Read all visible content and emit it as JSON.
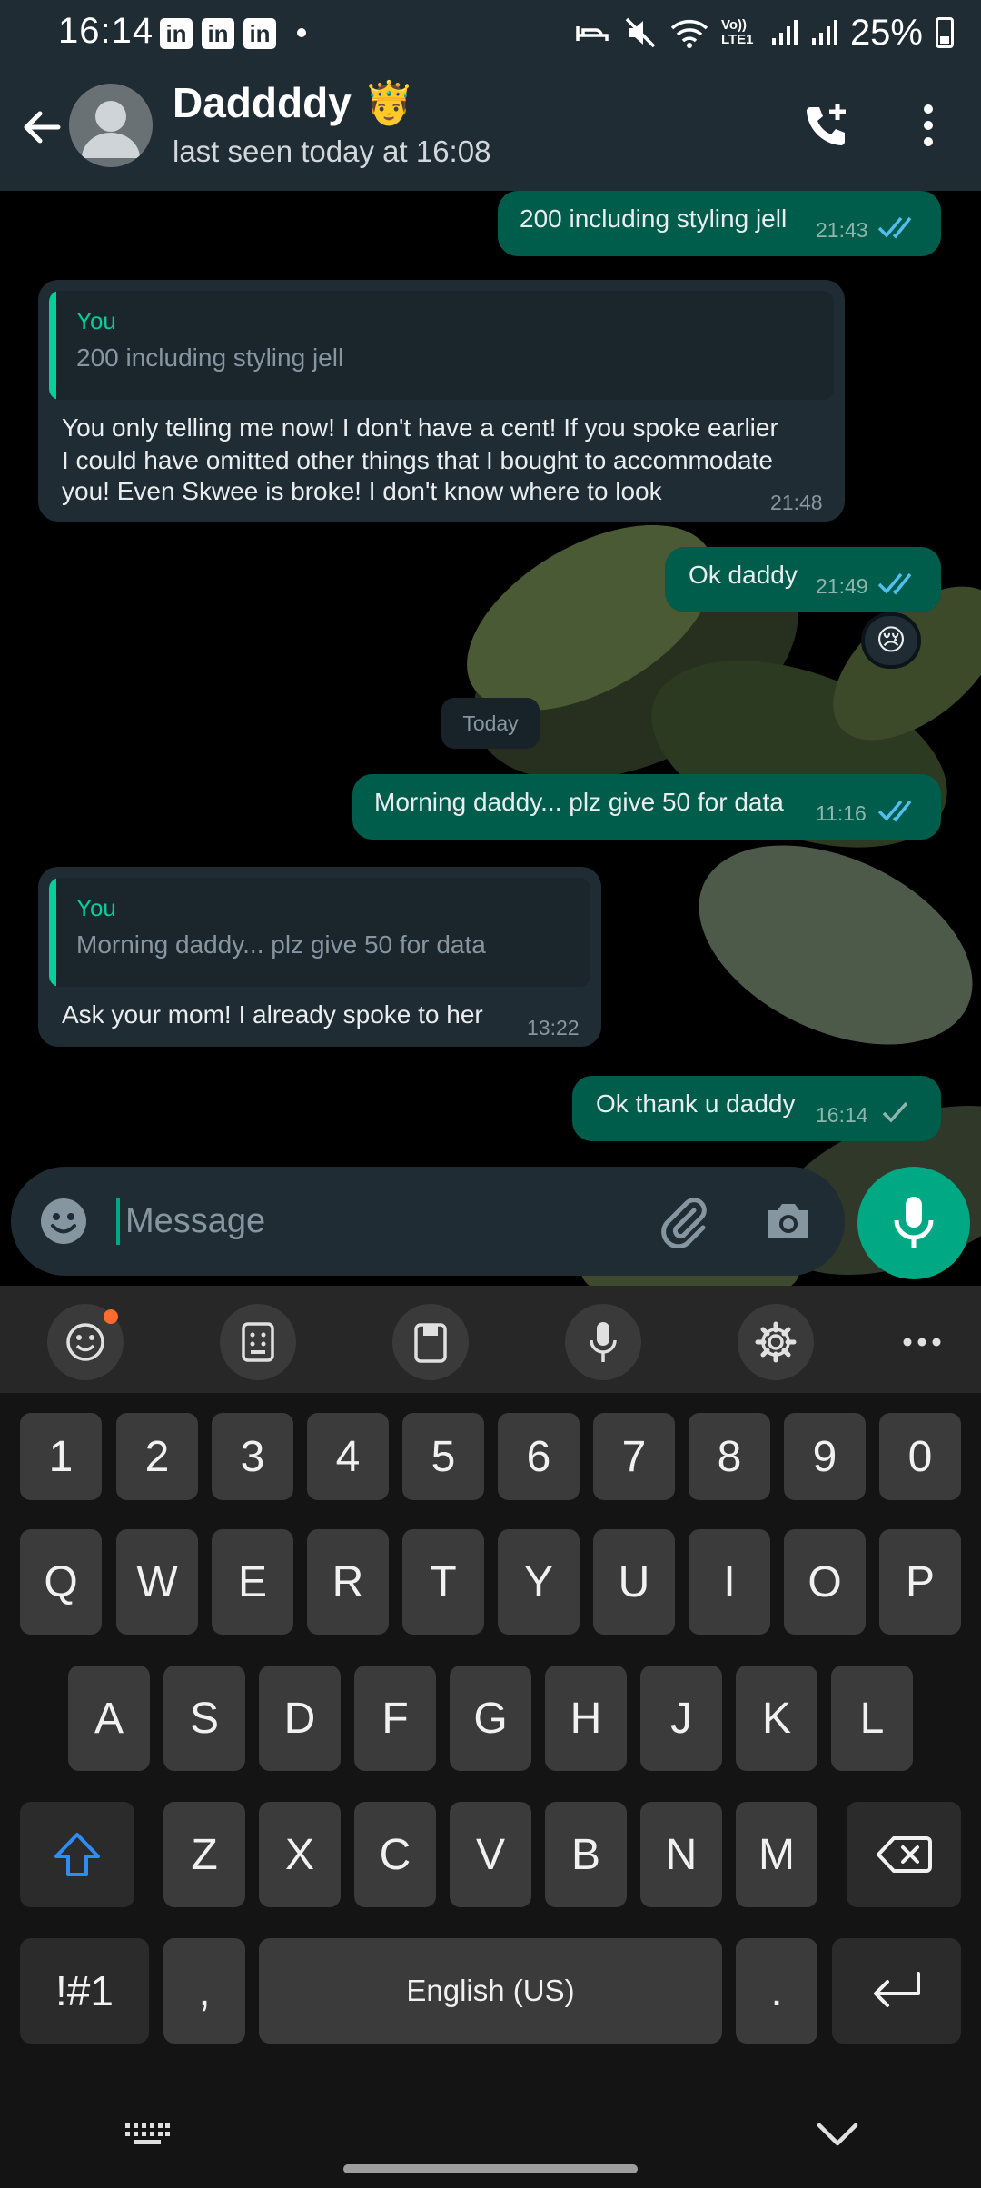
{
  "status_bar": {
    "time": "16:14",
    "notification_icons": [
      "in",
      "in",
      "in"
    ],
    "network_label": "Vo)) LTE1",
    "battery": "25%"
  },
  "header": {
    "contact_name": "Daddddy 🤴",
    "last_seen": "last seen today at 16:08"
  },
  "messages": [
    {
      "direction": "out",
      "text": "200 including styling jell",
      "time": "21:43",
      "status": "read"
    },
    {
      "direction": "in",
      "quote": {
        "author": "You",
        "text": "200 including styling jell"
      },
      "lines": [
        "You only telling me now! I don't have a cent! If you spoke earlier",
        "I could have omitted other things that I bought to accommodate",
        "you! Even Skwee is broke! I don't know where to look"
      ],
      "time": "21:48"
    },
    {
      "direction": "out",
      "text": "Ok daddy",
      "time": "21:49",
      "status": "read",
      "reaction": "😢"
    },
    {
      "direction": "out",
      "text": "Morning daddy... plz give 50 for data",
      "time": "11:16",
      "status": "read"
    },
    {
      "direction": "in",
      "quote": {
        "author": "You",
        "text": "Morning daddy... plz give 50 for data"
      },
      "text": "Ask your mom! I already spoke to her",
      "time": "13:22"
    },
    {
      "direction": "out",
      "text": "Ok thank u daddy",
      "time": "16:14",
      "status": "sent"
    }
  ],
  "day_separator": "Today",
  "composer": {
    "placeholder": "Message"
  },
  "keyboard": {
    "number_row": [
      "1",
      "2",
      "3",
      "4",
      "5",
      "6",
      "7",
      "8",
      "9",
      "0"
    ],
    "row1": [
      "Q",
      "W",
      "E",
      "R",
      "T",
      "Y",
      "U",
      "I",
      "O",
      "P"
    ],
    "row2": [
      "A",
      "S",
      "D",
      "F",
      "G",
      "H",
      "J",
      "K",
      "L"
    ],
    "row3": [
      "Z",
      "X",
      "C",
      "V",
      "B",
      "N",
      "M"
    ],
    "symbols_key": "!#1",
    "comma_key": ",",
    "space_label": "English (US)",
    "period_key": "."
  },
  "colors": {
    "accent": "#00a884",
    "outgoing_bubble": "#005c4b",
    "incoming_bubble": "#1f2c34",
    "read_tick": "#53bdeb",
    "header_bg": "#1f2c34"
  }
}
